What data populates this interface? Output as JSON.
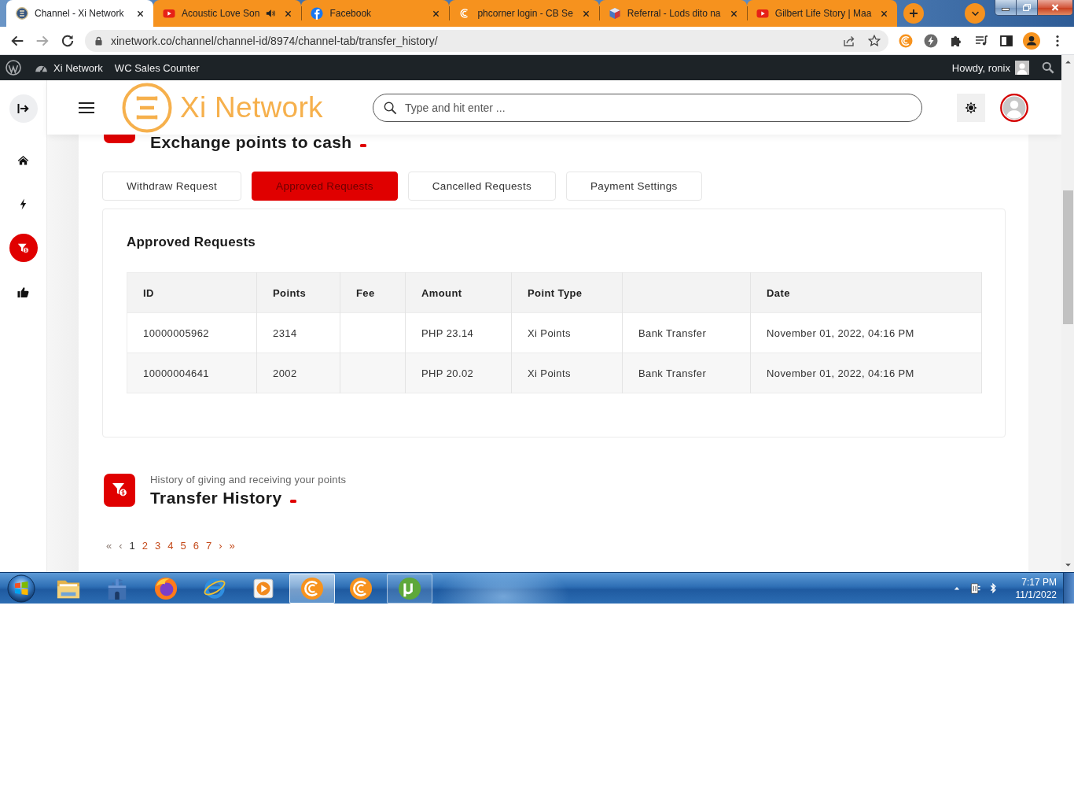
{
  "browser": {
    "tabs": [
      {
        "title": "Channel - Xi Network",
        "selected": true,
        "audio": false
      },
      {
        "title": "Acoustic Love Son",
        "selected": false,
        "audio": true
      },
      {
        "title": "Facebook",
        "selected": false,
        "audio": false
      },
      {
        "title": "phcorner login - CB Se",
        "selected": false,
        "audio": false
      },
      {
        "title": "Referral - Lods dito na",
        "selected": false,
        "audio": false
      },
      {
        "title": "Gilbert Life Story | Maa",
        "selected": false,
        "audio": false
      }
    ],
    "forward": {
      "disabled": true
    },
    "url": "xinetwork.co/channel/channel-id/8974/channel-tab/transfer_history/"
  },
  "wp_admin_bar": {
    "site": "Xi Network",
    "items": [
      "WC Sales Counter"
    ],
    "greeting": "Howdy, ronix"
  },
  "site_header": {
    "logo": "Xi Network",
    "search": {
      "placeholder": "Type and hit enter ..."
    }
  },
  "sidebar": {
    "items": [
      {
        "selected": false
      },
      {
        "selected": false
      },
      {
        "selected": true
      },
      {
        "selected": false
      }
    ]
  },
  "page": {
    "exchange_section": {
      "title": "Exchange points to cash"
    },
    "request_tabs": [
      {
        "label": "Withdraw Request",
        "selected": false
      },
      {
        "label": "Approved Requests",
        "selected": true
      },
      {
        "label": "Cancelled Requests",
        "selected": false
      },
      {
        "label": "Payment Settings",
        "selected": false
      }
    ],
    "approved_card": {
      "title": "Approved Requests",
      "table": {
        "columns": [
          "ID",
          "Points",
          "Fee",
          "Amount",
          "Point Type",
          null,
          "Date"
        ],
        "rows": [
          {
            "cells": [
              "10000005962",
              "2314",
              null,
              "PHP 23.14",
              "Xi Points",
              "Bank Transfer",
              "November 01, 2022, 04:16 PM"
            ]
          },
          {
            "cells": [
              "10000004641",
              "2002",
              null,
              "PHP 20.02",
              "Xi Points",
              "Bank Transfer",
              "November 01, 2022, 04:16 PM"
            ]
          }
        ]
      }
    },
    "transfer_section": {
      "subtitle": "History of giving and receiving your points",
      "title": "Transfer History"
    },
    "pagination": {
      "first": {
        "label": "«",
        "disabled": true
      },
      "prev": {
        "label": "‹",
        "disabled": true
      },
      "pages": [
        {
          "label": "1",
          "selected": true
        },
        {
          "label": "2",
          "selected": false
        },
        {
          "label": "3",
          "selected": false
        },
        {
          "label": "4",
          "selected": false
        },
        {
          "label": "5",
          "selected": false
        },
        {
          "label": "6",
          "selected": false
        },
        {
          "label": "7",
          "selected": false
        }
      ],
      "next": {
        "label": "›",
        "disabled": false
      },
      "last": {
        "label": "»",
        "disabled": false
      }
    }
  },
  "taskbar": {
    "apps": [
      {
        "running": false,
        "active": false
      },
      {
        "running": false,
        "active": false
      },
      {
        "running": false,
        "active": false
      },
      {
        "running": false,
        "active": false
      },
      {
        "running": false,
        "active": false
      },
      {
        "running": true,
        "active": true
      },
      {
        "running": false,
        "active": false
      },
      {
        "running": true,
        "active": false
      }
    ],
    "time": "7:17 PM",
    "date": "11/1/2022"
  }
}
